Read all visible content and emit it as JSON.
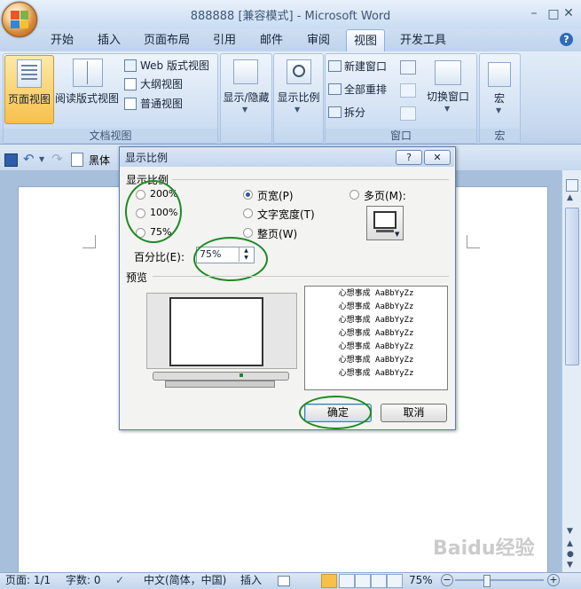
{
  "app": {
    "title": "888888 [兼容模式] - Microsoft Word"
  },
  "window_controls": {
    "minimize": "–",
    "restore": "□",
    "close": "✕"
  },
  "tabs": [
    {
      "label": "开始",
      "active": false
    },
    {
      "label": "插入",
      "active": false
    },
    {
      "label": "页面布局",
      "active": false
    },
    {
      "label": "引用",
      "active": false
    },
    {
      "label": "邮件",
      "active": false
    },
    {
      "label": "审阅",
      "active": false
    },
    {
      "label": "视图",
      "active": true
    },
    {
      "label": "开发工具",
      "active": false
    }
  ],
  "ribbon": {
    "doc_views": {
      "group_label": "文档视图",
      "print_layout": "页面视图",
      "full_reading": "阅读版式视图",
      "web_layout": "Web 版式视图",
      "outline": "大纲视图",
      "draft": "普通视图"
    },
    "show_hide": "显示/隐藏",
    "zoom": "显示比例",
    "window": {
      "group_label": "窗口",
      "new_window": "新建窗口",
      "arrange_all": "全部重排",
      "split": "拆分",
      "switch_windows": "切换窗口"
    },
    "macros": {
      "group_label": "宏",
      "label": "宏"
    }
  },
  "qat": {
    "font_name": "黑体"
  },
  "dialog": {
    "title": "显示比例",
    "help_btn": "?",
    "close_btn": "✕",
    "section_zoom": "显示比例",
    "zoom_options": [
      "200%",
      "100%",
      "75%"
    ],
    "page_width": "页宽(P)",
    "text_width": "文字宽度(T)",
    "whole_page": "整页(W)",
    "many_pages": "多页(M):",
    "percent_label": "百分比(E):",
    "percent_value": "75%",
    "preview_label": "预览",
    "preview_text_line": "心想事成 AaBbYyZz",
    "preview_lines": 7,
    "ok": "确定",
    "cancel": "取消",
    "selected_option": "页宽(P)"
  },
  "status_bar": {
    "page": "页面: 1/1",
    "words": "字数: 0",
    "language": "中文(简体，中国)",
    "insert": "插入",
    "zoom": "75%"
  },
  "watermark": "Baidu经验",
  "colors": {
    "accent_blue": "#2b57a0",
    "annotation_green": "#1c8a22",
    "office_orange": "#d9893a"
  }
}
